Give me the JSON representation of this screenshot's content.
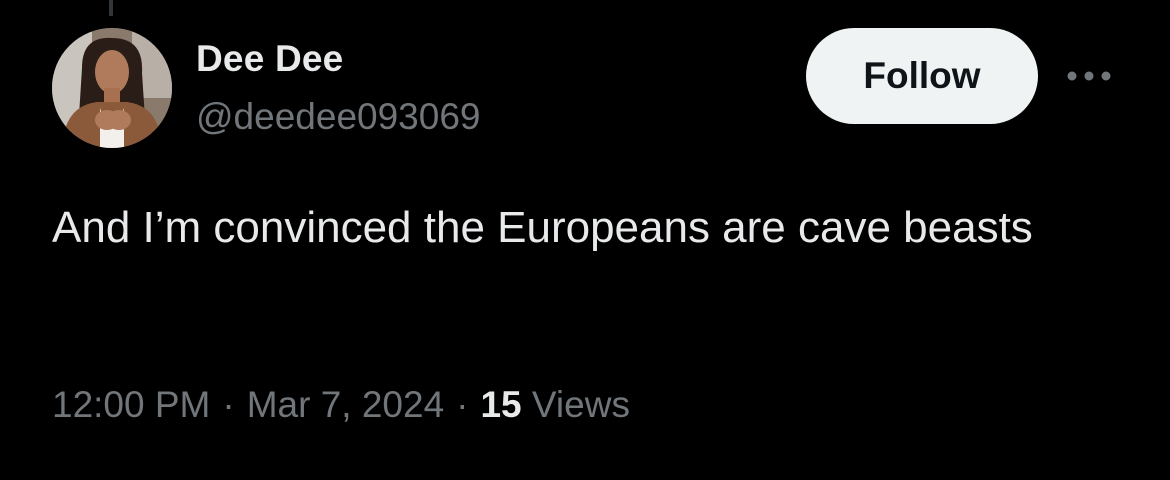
{
  "tweet": {
    "author": {
      "display_name": "Dee Dee",
      "handle": "@deedee093069",
      "avatar_icon": "profile-photo"
    },
    "follow_label": "Follow",
    "more_icon": "ellipsis-icon",
    "text": "And I’m convinced the Europeans are cave beasts",
    "time": "12:00 PM",
    "date": "Mar 7, 2024",
    "separator": "·",
    "views_count": "15",
    "views_label": "Views"
  },
  "colors": {
    "background": "#000000",
    "primary_text": "#e7e9ea",
    "secondary_text": "#71767b",
    "follow_button_bg": "#eff3f4",
    "follow_button_text": "#0f1419"
  }
}
